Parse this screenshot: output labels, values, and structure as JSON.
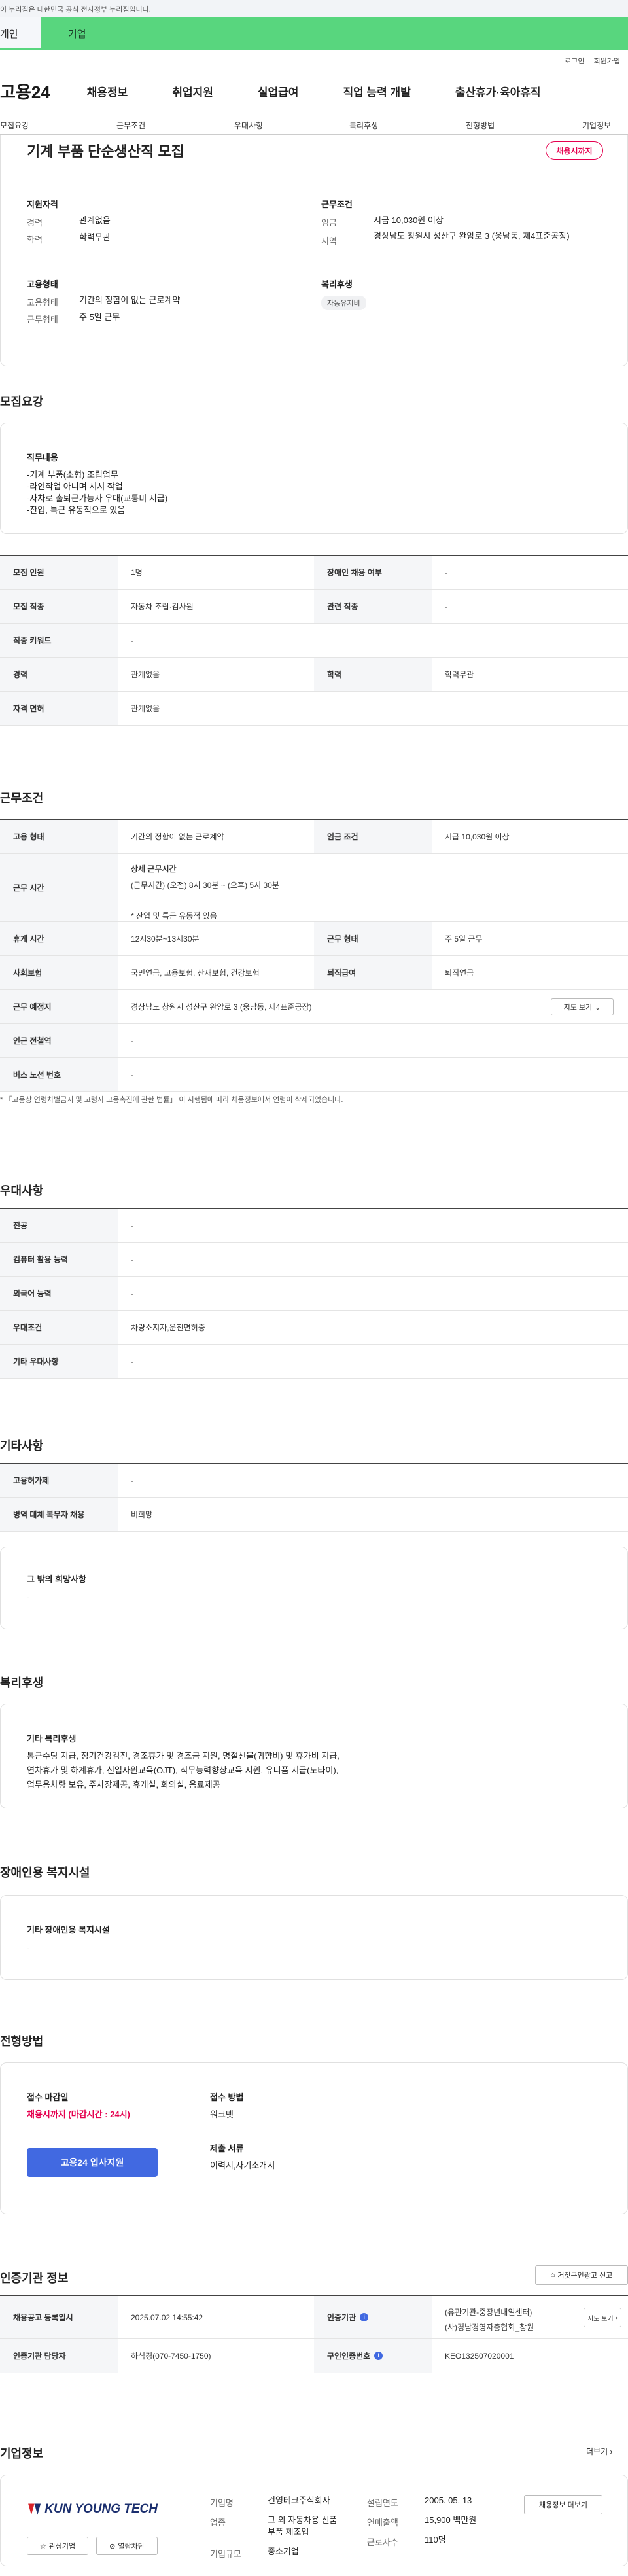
{
  "gov_banner": "이 누리집은 대한민국 공식 전자정부 누리집입니다.",
  "top_tabs": [
    "개인",
    "기업"
  ],
  "util": [
    "로그인",
    "회원가입"
  ],
  "logo": "고용24",
  "gnb": [
    "채용정보",
    "취업지원",
    "실업급여",
    "직업 능력 개발",
    "출산휴가·육아휴직"
  ],
  "anchor_tabs": [
    "모집요강",
    "근무조건",
    "우대사항",
    "복리후생",
    "전형방법",
    "기업정보"
  ],
  "title": "기계 부품 단순생산직 모집",
  "status_badge": "채용시까지",
  "summary": {
    "qual_title": "지원자격",
    "career_label": "경력",
    "career": "관계없음",
    "edu_label": "학력",
    "edu": "학력무관",
    "emp_title": "고용형태",
    "emp_type_label": "고용형태",
    "emp_type": "기간의 정함이 없는 근로계약",
    "work_type_label": "근무형태",
    "work_type": "주 5일 근무",
    "cond_title": "근무조건",
    "wage_label": "임금",
    "wage": "시급 10,030원 이상",
    "area_label": "지역",
    "area": "경상남도 창원시 성산구 완암로 3 (웅남동, 제4표준공장)",
    "welfare_title": "복리후생",
    "welfare_tag": "자동유지비"
  },
  "recruit": {
    "title": "모집요강",
    "duty_title": "직무내용",
    "duty_lines": [
      "-기계 부품(소형) 조립업무",
      "-라인작업 아니며 서서 작업",
      "-자차로 출퇴근가능자 우대(교통비 지급)",
      "-잔업, 특근 유동적으로 있음"
    ],
    "rows": [
      [
        "모집 인원",
        "1명",
        "장애인 채용 여부",
        "-"
      ],
      [
        "모집 직종",
        "자동차 조립·검사원",
        "관련 직종",
        "-"
      ],
      [
        "직종 키워드",
        "-"
      ],
      [
        "경력",
        "관계없음",
        "학력",
        "학력무관"
      ],
      [
        "자격 면허",
        "관계없음"
      ]
    ]
  },
  "work": {
    "title": "근무조건",
    "emp_label": "고용 형태",
    "emp": "기간의 정함이 없는 근로계약",
    "wage_label": "임금 조건",
    "wage": "시급 10,030원 이상",
    "time_label": "근무 시간",
    "time_title": "상세 근무시간",
    "time_detail": "(근무시간) (오전) 8시 30분 ~ (오후) 5시 30분",
    "time_note": "* 잔업 및 특근 유동적 있음",
    "rest_label": "휴게 시간",
    "rest": "12시30분~13시30분",
    "form_label": "근무 형태",
    "form": "주 5일 근무",
    "ins_label": "사회보험",
    "ins": "국민연금, 고용보험, 산재보험, 건강보험",
    "ret_label": "퇴직급여",
    "ret": "퇴직연금",
    "place_label": "근무 예정지",
    "place": "경상남도 창원시 성산구 완암로 3 (웅남동, 제4표준공장)",
    "map_btn": "지도 보기",
    "station_label": "인근 전철역",
    "station": "-",
    "bus_label": "버스 노선 번호",
    "bus": "-",
    "note": "* 「고용상 연령차별금지 및 고령자 고용촉진에 관한 법률」 이 시행됨에 따라 채용정보에서 연령이 삭제되었습니다."
  },
  "pref": {
    "title": "우대사항",
    "rows": [
      [
        "전공",
        "-"
      ],
      [
        "컴퓨터 활용 능력",
        "-"
      ],
      [
        "외국어 능력",
        "-"
      ],
      [
        "우대조건",
        "차량소지자,운전면허증"
      ],
      [
        "기타 우대사항",
        "-"
      ]
    ]
  },
  "etc": {
    "title": "기타사항",
    "rows": [
      [
        "고용허가제",
        "-"
      ],
      [
        "병역 대체 복무자 채용",
        "비희망"
      ]
    ],
    "extra_title": "그 밖의 희망사항",
    "extra": "-"
  },
  "welfare": {
    "title": "복리후생",
    "sub": "기타 복리후생",
    "text": [
      "통근수당 지급, 정기건강검진, 경조휴가 및 경조금 지원, 명절선물(귀향비) 및 휴가비 지급,",
      "연차휴가 및 하계휴가, 신입사원교육(OJT), 직무능력향상교육 지원, 유니폼 지급(노타이),",
      "업무용차량 보유, 주차장제공, 휴게실, 회의실, 음료제공"
    ]
  },
  "disab": {
    "title": "장애인용 복지시설",
    "sub": "기타 장애인용 복지시설",
    "val": "-"
  },
  "process": {
    "title": "전형방법",
    "deadline_label": "접수 마감일",
    "deadline": "채용시까지 (마감시간 : 24시)",
    "apply_btn": "고용24 입사지원",
    "method_label": "접수 방법",
    "method": "워크넷",
    "docs_label": "제출 서류",
    "docs": "이력서,자기소개서"
  },
  "cert": {
    "title": "인증기관 정보",
    "report_btn": "거짓구인광고 신고",
    "reg_label": "채용공고 등록일시",
    "reg": "2025.07.02 14:55:42",
    "org_label": "인증기관",
    "org1": "(유관기관-중장년내일센터)",
    "org2": "(사)경남경영자총협회_창원",
    "map_btn": "지도 보기",
    "manager_label": "인증기관 담당자",
    "manager": "하석경(070-7450-1750)",
    "no_label": "구인인증번호",
    "no": "KEO132507020001"
  },
  "company": {
    "title": "기업정보",
    "more": "더보기",
    "logo_text": "KUN YOUNG TECH",
    "fav_btn": "관심기업",
    "block_btn": "열람차단",
    "name_label": "기업명",
    "name": "건영테크주식회사",
    "biz_label": "업종",
    "biz": "그 외 자동차용 신품 부품 제조업",
    "size_label": "기업규모",
    "size": "중소기업",
    "year_label": "설립연도",
    "year": "2005. 05. 13",
    "sales_label": "연매출액",
    "sales": "15,900 백만원",
    "emp_label": "근로자수",
    "emp": "110명",
    "jobs_btn": "채용정보 더보기"
  },
  "colors": {
    "green": "#58d67e",
    "accent": "#e5004f",
    "blue": "#4169e1"
  }
}
